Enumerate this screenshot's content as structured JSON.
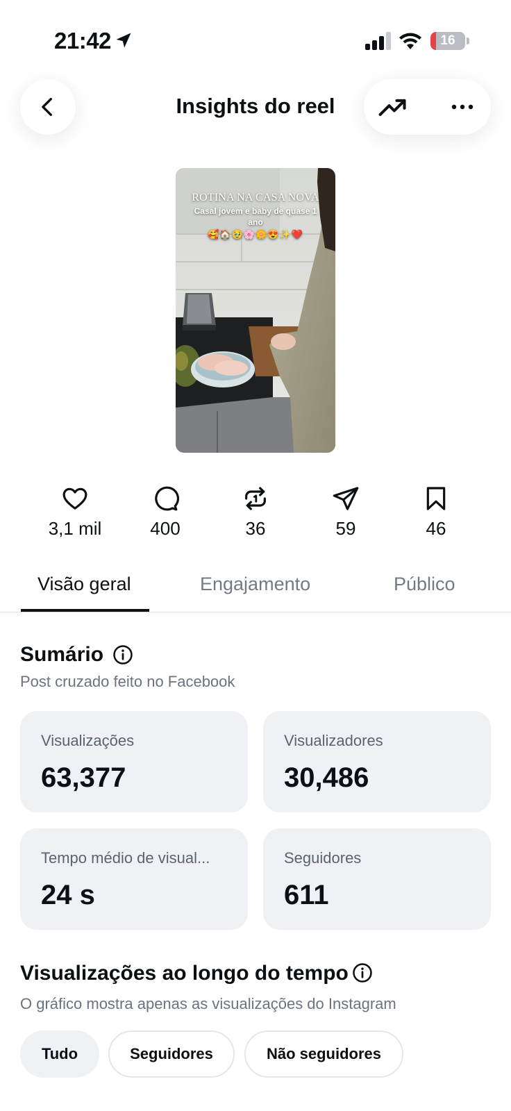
{
  "status_bar": {
    "time": "21:42",
    "battery": "16",
    "battery_level": 0.16,
    "icons": [
      "location-arrow-icon",
      "cellular-signal-icon",
      "wifi-icon",
      "battery-icon"
    ]
  },
  "header": {
    "title": "Insights do reel",
    "icons": [
      "chevron-left-icon",
      "trending-up-icon",
      "more-horizontal-icon"
    ]
  },
  "reel": {
    "overlay_title": "ROTINA NA CASA NOVA",
    "overlay_subtitle": "Casal jovem e baby de quase 1 ano",
    "overlay_emojis": "🥰🏠🥹🌸🌼😍✨❤️"
  },
  "stats": [
    {
      "icon": "heart-icon",
      "value": "3,1 mil"
    },
    {
      "icon": "comment-icon",
      "value": "400"
    },
    {
      "icon": "repost-icon",
      "value": "36"
    },
    {
      "icon": "share-icon",
      "value": "59"
    },
    {
      "icon": "bookmark-icon",
      "value": "46"
    }
  ],
  "tabs": [
    {
      "label": "Visão geral",
      "active": true
    },
    {
      "label": "Engajamento",
      "active": false
    },
    {
      "label": "Público",
      "active": false
    }
  ],
  "summary": {
    "title": "Sumário",
    "subtitle": "Post cruzado feito no Facebook",
    "cards": [
      {
        "label": "Visualizações",
        "value": "63,377"
      },
      {
        "label": "Visualizadores",
        "value": "30,486"
      },
      {
        "label": "Tempo médio de visual...",
        "value": "24 s"
      },
      {
        "label": "Seguidores",
        "value": "611"
      }
    ]
  },
  "views_over_time": {
    "title": "Visualizações ao longo do tempo",
    "subtitle": "O gráfico mostra apenas as visualizações do Instagram",
    "filters": [
      {
        "label": "Tudo",
        "selected": true
      },
      {
        "label": "Seguidores",
        "selected": false
      },
      {
        "label": "Não seguidores",
        "selected": false
      }
    ]
  },
  "colors": {
    "text": "#0c1014",
    "muted": "#737a86",
    "card_bg": "#eff1f5",
    "battery_low": "#e5434a"
  }
}
